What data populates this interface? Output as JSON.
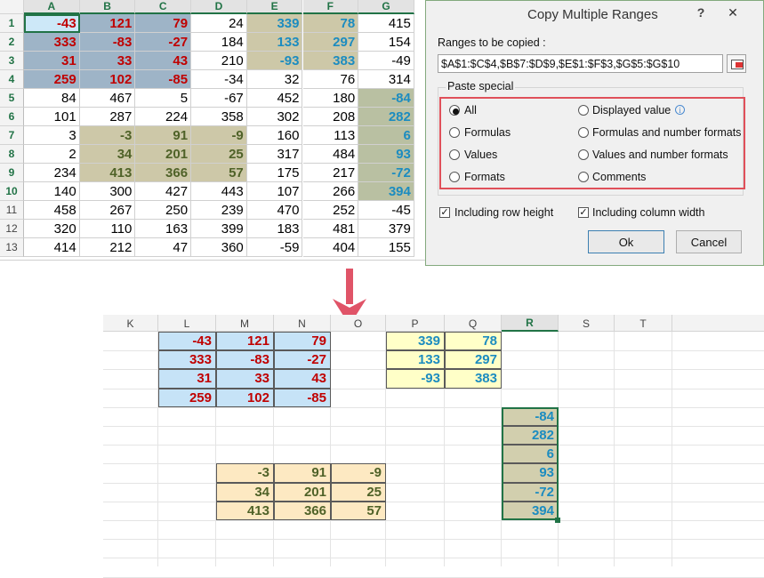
{
  "top_sheet": {
    "columns": [
      "A",
      "B",
      "C",
      "D",
      "E",
      "F",
      "G"
    ],
    "rows": [
      "1",
      "2",
      "3",
      "4",
      "5",
      "6",
      "7",
      "8",
      "9",
      "10",
      "11",
      "12",
      "13"
    ],
    "cells": [
      [
        "-43",
        "121",
        "79",
        "24",
        "339",
        "78",
        "415"
      ],
      [
        "333",
        "-83",
        "-27",
        "184",
        "133",
        "297",
        "154"
      ],
      [
        "31",
        "33",
        "43",
        "210",
        "-93",
        "383",
        "-49"
      ],
      [
        "259",
        "102",
        "-85",
        "-34",
        "32",
        "76",
        "314"
      ],
      [
        "84",
        "467",
        "5",
        "-67",
        "452",
        "180",
        "-84"
      ],
      [
        "101",
        "287",
        "224",
        "358",
        "302",
        "208",
        "282"
      ],
      [
        "3",
        "-3",
        "91",
        "-9",
        "160",
        "113",
        "6"
      ],
      [
        "2",
        "34",
        "201",
        "25",
        "317",
        "484",
        "93"
      ],
      [
        "234",
        "413",
        "366",
        "57",
        "175",
        "217",
        "-72"
      ],
      [
        "140",
        "300",
        "427",
        "443",
        "107",
        "266",
        "394"
      ],
      [
        "458",
        "267",
        "250",
        "239",
        "470",
        "252",
        "-45"
      ],
      [
        "320",
        "110",
        "163",
        "399",
        "183",
        "481",
        "379"
      ],
      [
        "414",
        "212",
        "47",
        "360",
        "-59",
        "404",
        "155"
      ]
    ],
    "colors": {
      "range1": "#9eb4c7",
      "range2": "#cdc8a8",
      "range3": "#cdc8a8",
      "range4": "#b9c0a2",
      "selected_a1": "#cde8f8"
    }
  },
  "dialog": {
    "title": "Copy Multiple Ranges",
    "help_icon": "?",
    "close_icon": "✕",
    "ranges_label": "Ranges to be copied :",
    "ranges_value": "$A$1:$C$4,$B$7:$D$9,$E$1:$F$3,$G$5:$G$10",
    "range_picker_icon": "range-select-icon",
    "paste_special_label": "Paste special",
    "options_left": [
      "All",
      "Formulas",
      "Values",
      "Formats"
    ],
    "options_right": [
      "Displayed value",
      "Formulas and number formats",
      "Values and number formats",
      "Comments"
    ],
    "selected_option": "All",
    "info_icon": "i",
    "check_row_height": "Including row height",
    "check_col_width": "Including column width",
    "ok_label": "Ok",
    "cancel_label": "Cancel",
    "highlight_color": "#e0505a"
  },
  "arrow": {
    "color": "#e05468",
    "icon": "down-arrow-icon"
  },
  "bottom_sheet": {
    "columns": [
      "K",
      "L",
      "M",
      "N",
      "O",
      "P",
      "Q",
      "R",
      "S",
      "T"
    ],
    "block1": [
      [
        "-43",
        "121",
        "79"
      ],
      [
        "333",
        "-83",
        "-27"
      ],
      [
        "31",
        "33",
        "43"
      ],
      [
        "259",
        "102",
        "-85"
      ]
    ],
    "block2": [
      [
        "339",
        "78"
      ],
      [
        "133",
        "297"
      ],
      [
        "-93",
        "383"
      ]
    ],
    "block3": [
      "-84",
      "282",
      "6",
      "93",
      "-72",
      "394"
    ],
    "block4": [
      [
        "-3",
        "91",
        "-9"
      ],
      [
        "34",
        "201",
        "25"
      ],
      [
        "413",
        "366",
        "57"
      ]
    ],
    "colors": {
      "block1": "#c6e3f7",
      "block2": "#ffffc8",
      "block3": "#d2cfae",
      "block4": "#fde9c2"
    }
  }
}
